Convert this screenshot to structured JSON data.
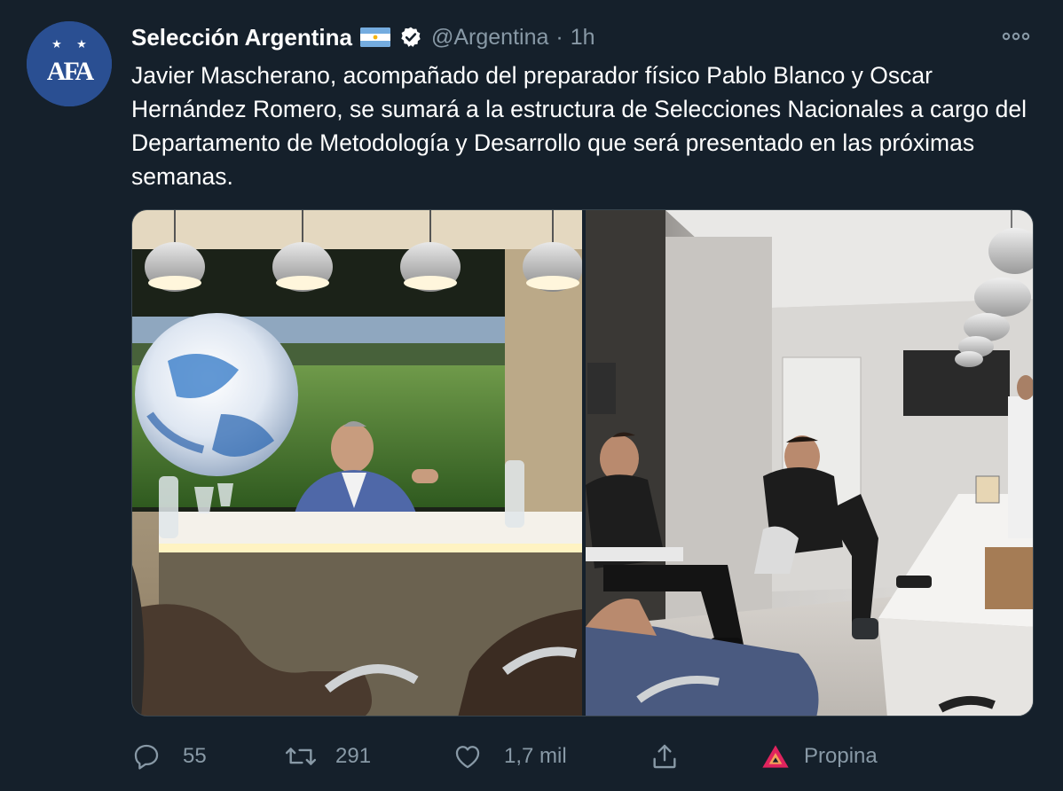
{
  "account": {
    "display_name": "Selección Argentina",
    "handle": "@Argentina",
    "separator": "·",
    "timestamp": "1h",
    "avatar_icon": "afa-crest-icon",
    "avatar_text": "AFA",
    "verified_icon": "verified-badge-icon",
    "flag_icon": "argentina-flag-icon"
  },
  "tweet": {
    "text": "Javier Mascherano, acompañado del preparador físico Pablo Blanco y Oscar Hernández Romero, se sumará a la estructura de Selecciones Nacionales a cargo del Departamento de Metodología y Desarrollo que será presentado en las próximas semanas."
  },
  "media": {
    "photos": [
      {
        "subject": "meeting-room-photo-left"
      },
      {
        "subject": "meeting-room-photo-right"
      }
    ]
  },
  "actions": {
    "reply": {
      "icon": "reply-icon",
      "count": "55"
    },
    "retweet": {
      "icon": "retweet-icon",
      "count": "291"
    },
    "like": {
      "icon": "heart-icon",
      "count": "1,7 mil"
    },
    "share": {
      "icon": "share-icon"
    },
    "tip": {
      "icon": "tip-jar-icon",
      "label": "Propina"
    }
  },
  "colors": {
    "background": "#15202b",
    "secondary_text": "#8899a6",
    "verified": "#ffffff",
    "avatar_bg": "#2a4f92"
  }
}
